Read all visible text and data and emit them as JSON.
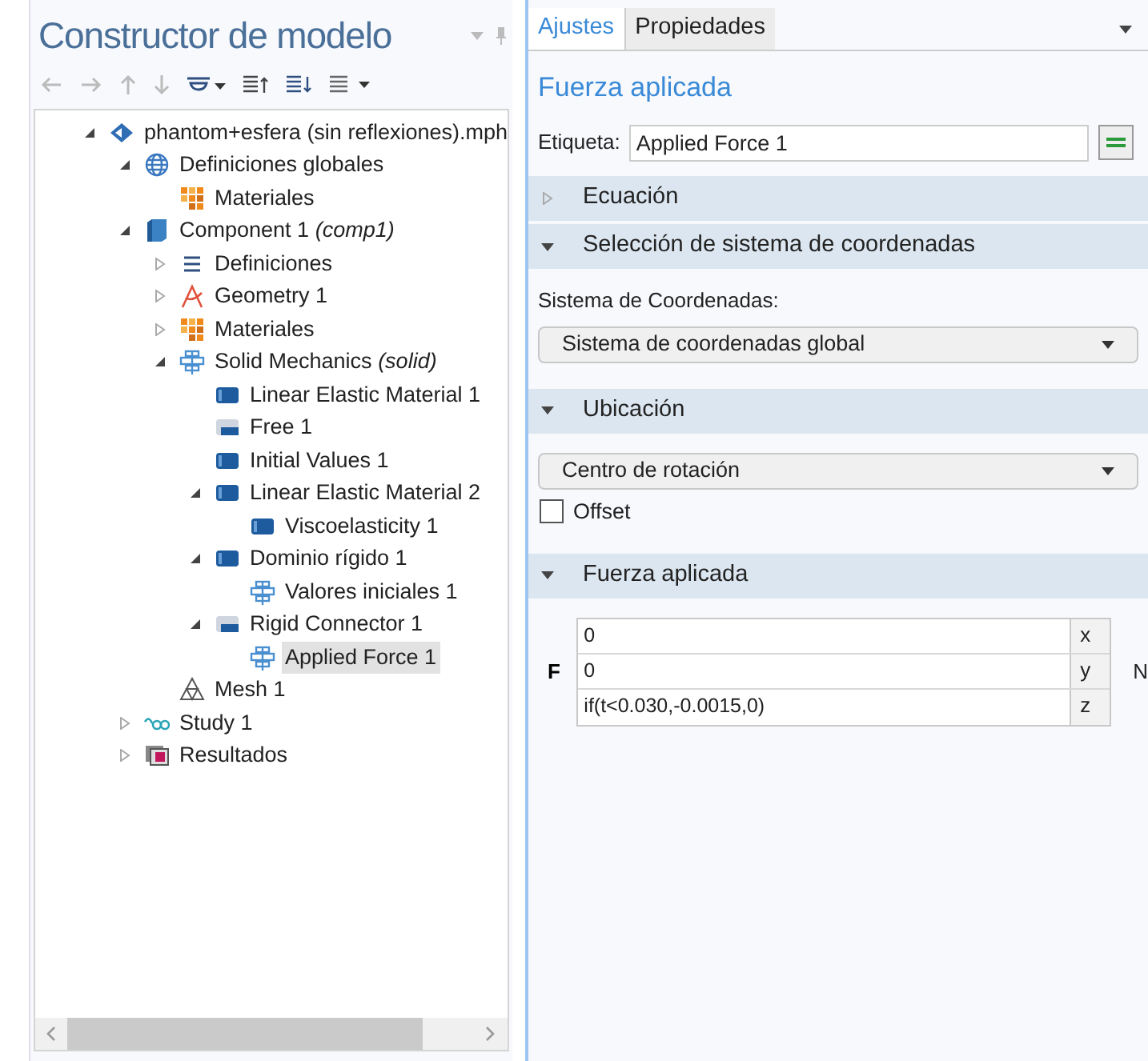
{
  "model_builder": {
    "title": "Constructor de modelo",
    "tree": [
      {
        "label": "phantom+esfera (sin reflexiones).mph",
        "kind": "model",
        "expanded": true,
        "selected": false,
        "children": [
          {
            "label": "Definiciones globales",
            "kind": "globe",
            "expanded": true,
            "selected": false,
            "children": [
              {
                "label": "Materiales",
                "kind": "materials",
                "selected": false
              }
            ]
          },
          {
            "label": "Component 1",
            "tag": "(comp1)",
            "kind": "component",
            "expanded": true,
            "selected": false,
            "children": [
              {
                "label": "Definiciones",
                "kind": "definitions",
                "expanded": false,
                "selected": false
              },
              {
                "label": "Geometry 1",
                "kind": "geometry",
                "expanded": false,
                "selected": false
              },
              {
                "label": "Materiales",
                "kind": "materials",
                "expanded": false,
                "selected": false
              },
              {
                "label": "Solid Mechanics",
                "tag": "(solid)",
                "kind": "physics",
                "expanded": true,
                "selected": false,
                "children": [
                  {
                    "label": "Linear Elastic Material 1",
                    "kind": "domain-default",
                    "selected": false
                  },
                  {
                    "label": "Free 1",
                    "kind": "boundary-default",
                    "selected": false
                  },
                  {
                    "label": "Initial Values 1",
                    "kind": "domain-default",
                    "selected": false
                  },
                  {
                    "label": "Linear Elastic Material 2",
                    "kind": "domain",
                    "expanded": true,
                    "selected": false,
                    "children": [
                      {
                        "label": "Viscoelasticity 1",
                        "kind": "domain",
                        "selected": false
                      }
                    ]
                  },
                  {
                    "label": "Dominio rígido 1",
                    "kind": "domain",
                    "expanded": true,
                    "selected": false,
                    "children": [
                      {
                        "label": "Valores iniciales 1",
                        "kind": "physics-default",
                        "selected": false
                      }
                    ]
                  },
                  {
                    "label": "Rigid Connector 1",
                    "kind": "boundary",
                    "expanded": true,
                    "selected": false,
                    "children": [
                      {
                        "label": "Applied Force 1",
                        "kind": "physics",
                        "selected": true
                      }
                    ]
                  }
                ]
              },
              {
                "label": "Mesh 1",
                "kind": "mesh",
                "selected": false
              }
            ]
          },
          {
            "label": "Study 1",
            "kind": "study",
            "expanded": false,
            "selected": false
          },
          {
            "label": "Resultados",
            "kind": "results",
            "expanded": false,
            "selected": false
          }
        ]
      }
    ]
  },
  "settings": {
    "tabs": [
      {
        "label": "Ajustes",
        "selected": true
      },
      {
        "label": "Propiedades",
        "selected": false
      }
    ],
    "title": "Fuerza aplicada",
    "label_field": {
      "label": "Etiqueta:",
      "value": "Applied Force 1"
    },
    "sections": [
      {
        "title": "Ecuación",
        "expanded": false,
        "kind": "empty"
      },
      {
        "title": "Selección de sistema de coordenadas",
        "expanded": true,
        "kind": "select",
        "field_label": "Sistema de Coordenadas:",
        "value": "Sistema de coordenadas global"
      },
      {
        "title": "Ubicación",
        "expanded": true,
        "kind": "select-check",
        "value": "Centro de rotación",
        "checkbox": {
          "label": "Offset",
          "checked": false
        }
      },
      {
        "title": "Fuerza aplicada",
        "expanded": true,
        "kind": "vector",
        "symbol": "F",
        "unit": "N",
        "rows": [
          {
            "value": "0",
            "component": "x"
          },
          {
            "value": "0",
            "component": "y"
          },
          {
            "value": "if(t<0.030,-0.0015,0)",
            "component": "z"
          }
        ]
      }
    ]
  }
}
